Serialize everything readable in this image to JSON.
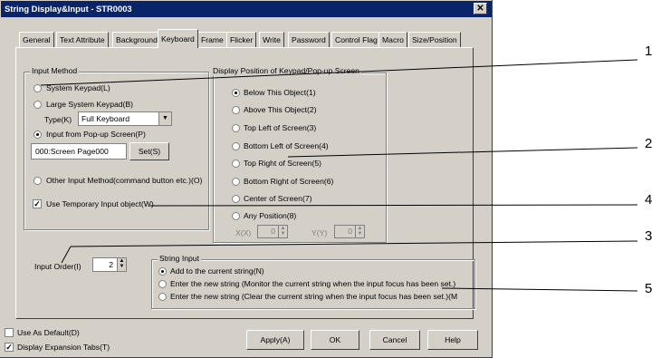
{
  "window": {
    "title": "String Display&Input - STR0003",
    "close_glyph": "✕"
  },
  "tabs": [
    "General",
    "Text Attribute",
    "Background",
    "Keyboard",
    "Frame",
    "Flicker",
    "Write",
    "Password",
    "Control Flag",
    "Macro",
    "Size/Position"
  ],
  "active_tab": "Keyboard",
  "input_method": {
    "legend": "Input Method",
    "system_keypad": "System Keypad(L)",
    "large_keypad": "Large System Keypad(B)",
    "type_label": "Type(K)",
    "type_value": "Full Keyboard",
    "popup": "Input from Pop-up Screen(P)",
    "popup_screen": "000:Screen Page000",
    "set_button": "Set(S)",
    "other": "Other Input Method(command button etc.)(O)",
    "use_temp": "Use Temporary Input object(W)"
  },
  "display_position": {
    "legend": "Display Position of Keypad/Pop-up Screen",
    "options": [
      "Below This Object(1)",
      "Above This Object(2)",
      "Top Left of Screen(3)",
      "Bottom Left of Screen(4)",
      "Top Right of Screen(5)",
      "Bottom Right of Screen(6)",
      "Center of Screen(7)",
      "Any Position(8)"
    ],
    "selected": "Below This Object(1)",
    "x_label": "X(X)",
    "x_value": "0",
    "y_label": "Y(Y)",
    "y_value": "0"
  },
  "input_order": {
    "label": "Input Order(I)",
    "value": "2"
  },
  "string_input": {
    "legend": "String Input",
    "options": [
      "Add to the current string(N)",
      "Enter the new string (Monitor the current string when the input focus has been set.)",
      "Enter the new string (Clear the current string when the input focus has been set.)(M"
    ],
    "selected": "Add to the current string(N)"
  },
  "footer": {
    "use_default": "Use As Default(D)",
    "expansion_tabs": "Display Expansion Tabs(T)",
    "apply": "Apply(A)",
    "ok": "OK",
    "cancel": "Cancel",
    "help": "Help"
  },
  "callouts": [
    "1",
    "2",
    "4",
    "3",
    "5"
  ]
}
